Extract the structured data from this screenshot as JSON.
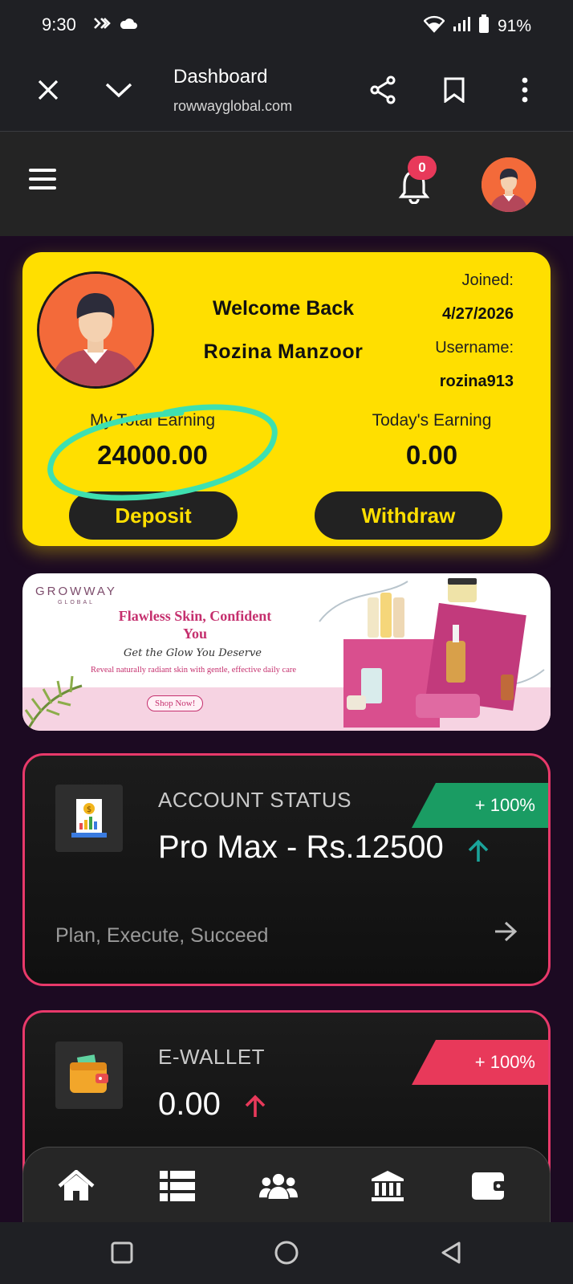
{
  "status_bar": {
    "time": "9:30",
    "battery": "91%",
    "icons": [
      "link-icon",
      "cloud-icon",
      "wifi-icon",
      "signal-icon",
      "battery-icon"
    ]
  },
  "browser": {
    "title": "Dashboard",
    "url": "rowwayglobal.com",
    "buttons": [
      "close-icon",
      "chevron-down-icon",
      "share-icon",
      "bookmark-icon",
      "more-vert-icon"
    ]
  },
  "app_header": {
    "notification_count": "0"
  },
  "welcome_card": {
    "greeting": "Welcome Back",
    "name": "Rozina Manzoor",
    "joined_label": "Joined:",
    "joined_value": "4/27/2026",
    "username_label": "Username:",
    "username_value": "rozina913",
    "total_earning_label": "My Total Earning",
    "total_earning_value": "24000.00",
    "today_earning_label": "Today's Earning",
    "today_earning_value": "0.00",
    "deposit_label": "Deposit",
    "withdraw_label": "Withdraw"
  },
  "banner": {
    "logo": "GROWWAY",
    "logo_sub": "GLOBAL",
    "headline": "Flawless Skin, Confident You",
    "script": "Get the Glow You Deserve",
    "subtext": "Reveal naturally radiant skin with gentle, effective daily care",
    "cta": "Shop Now!"
  },
  "cards": [
    {
      "label": "ACCOUNT STATUS",
      "value": "Pro Max - Rs.12500",
      "badge": "+ 100%",
      "footer": "Plan, Execute, Succeed",
      "trend": "up",
      "badge_color": "#1a9c63",
      "arrow_color": "#1aa39a"
    },
    {
      "label": "E-WALLET",
      "value": "0.00",
      "badge": "+ 100%",
      "trend": "up",
      "badge_color": "#e8395a",
      "arrow_color": "#e8395a"
    }
  ],
  "bottom_nav": [
    "home-icon",
    "list-icon",
    "users-icon",
    "bank-icon",
    "wallet-icon"
  ],
  "system_nav": [
    "recents-icon",
    "home-circle-icon",
    "back-icon"
  ],
  "colors": {
    "accent_yellow": "#ffdf00",
    "card_border": "#e8396a",
    "background": "#1c0a22",
    "highlight_marker": "#3ee0b0"
  }
}
